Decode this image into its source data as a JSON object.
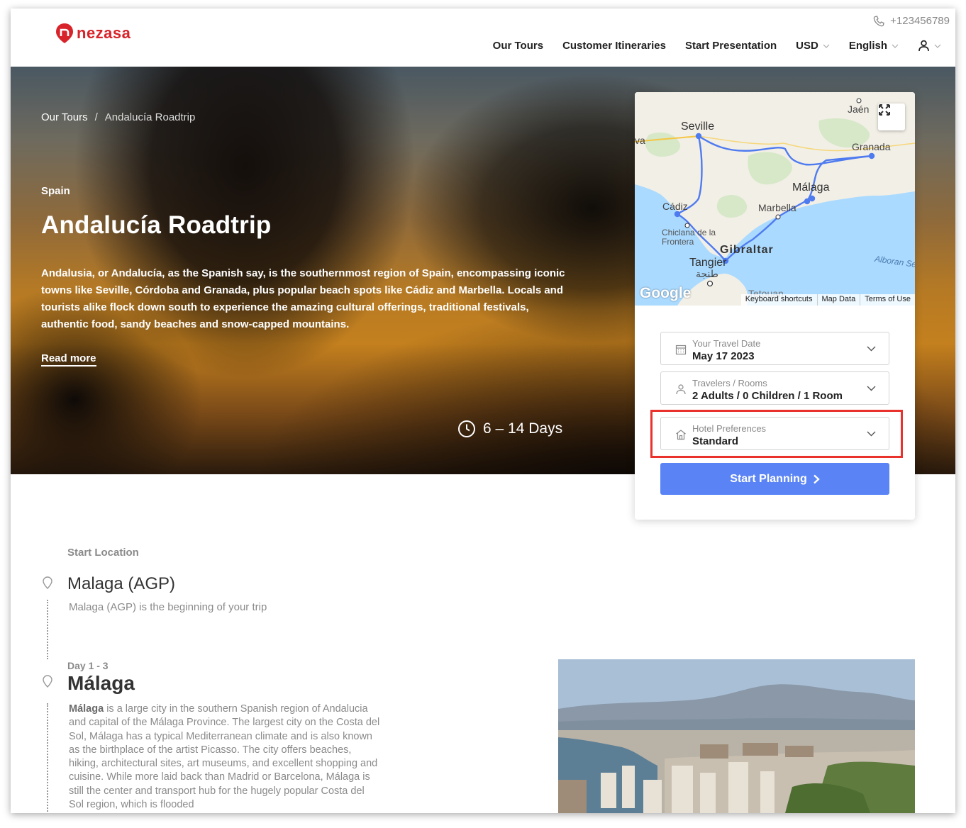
{
  "brand": {
    "name": "nezasa",
    "color": "#d8232a"
  },
  "header": {
    "phone": "+123456789",
    "nav": [
      {
        "label": "Our Tours"
      },
      {
        "label": "Customer Itineraries"
      },
      {
        "label": "Start Presentation"
      },
      {
        "label": "USD"
      },
      {
        "label": "English"
      }
    ]
  },
  "hero": {
    "breadcrumb": {
      "root": "Our Tours",
      "separator": "/",
      "current": "Andalucía Roadtrip"
    },
    "country": "Spain",
    "title": "Andalucía Roadtrip",
    "description": "Andalusia, or Andalucía, as the Spanish say, is the southernmost region of Spain, encompassing iconic towns like Seville, Córdoba and Granada, plus popular beach spots like Cádiz and Marbella. Locals and tourists alike flock down south to experience the amazing cultural offerings, traditional festivals, authentic food, sandy beaches and snow-capped mountains.",
    "read_more": "Read more",
    "duration": "6 – 14 Days"
  },
  "map": {
    "labels": {
      "jaen": "Jaén",
      "seville": "Seville",
      "va": "va",
      "granada": "Granada",
      "malaga": "Málaga",
      "cadiz": "Cádiz",
      "marbella": "Marbella",
      "chiclana": "Chiclana de la Frontera",
      "gibraltar": "Gibraltar",
      "tangier": "Tangier",
      "tangier_ar": "طنجة",
      "tetouan": "Tetouan",
      "alboran": "Alboran Se"
    },
    "google": "Google",
    "footer": [
      "Keyboard shortcuts",
      "Map Data",
      "Terms of Use"
    ],
    "route_color": "#4f7bf0"
  },
  "booking": {
    "travel_date": {
      "label": "Your Travel Date",
      "value": "May 17 2023"
    },
    "travelers": {
      "label": "Travelers / Rooms",
      "value": "2 Adults / 0 Children / 1 Room"
    },
    "hotel": {
      "label": "Hotel Preferences",
      "value": "Standard"
    },
    "start_button": "Start Planning",
    "accent": "#5a84f5",
    "highlight_color": "#e8322b"
  },
  "itinerary": {
    "start_label": "Start Location",
    "start_title": "Malaga (AGP)",
    "start_sub": "Malaga (AGP) is the beginning of your trip",
    "day_label": "Day 1 - 3",
    "day_title": "Málaga",
    "day_lead": "Málaga",
    "day_text": " is a large city in the southern Spanish region of Andalucia and capital of the Málaga Province. The largest city on the Costa del Sol, Málaga has a typical Mediterranean climate and is also known as the birthplace of the artist Picasso. The city offers beaches, hiking, architectural sites, art museums, and excellent shopping and cuisine. While more laid back than Madrid or Barcelona, Málaga is still the center and transport hub for the hugely popular Costa del Sol region, which is flooded"
  }
}
